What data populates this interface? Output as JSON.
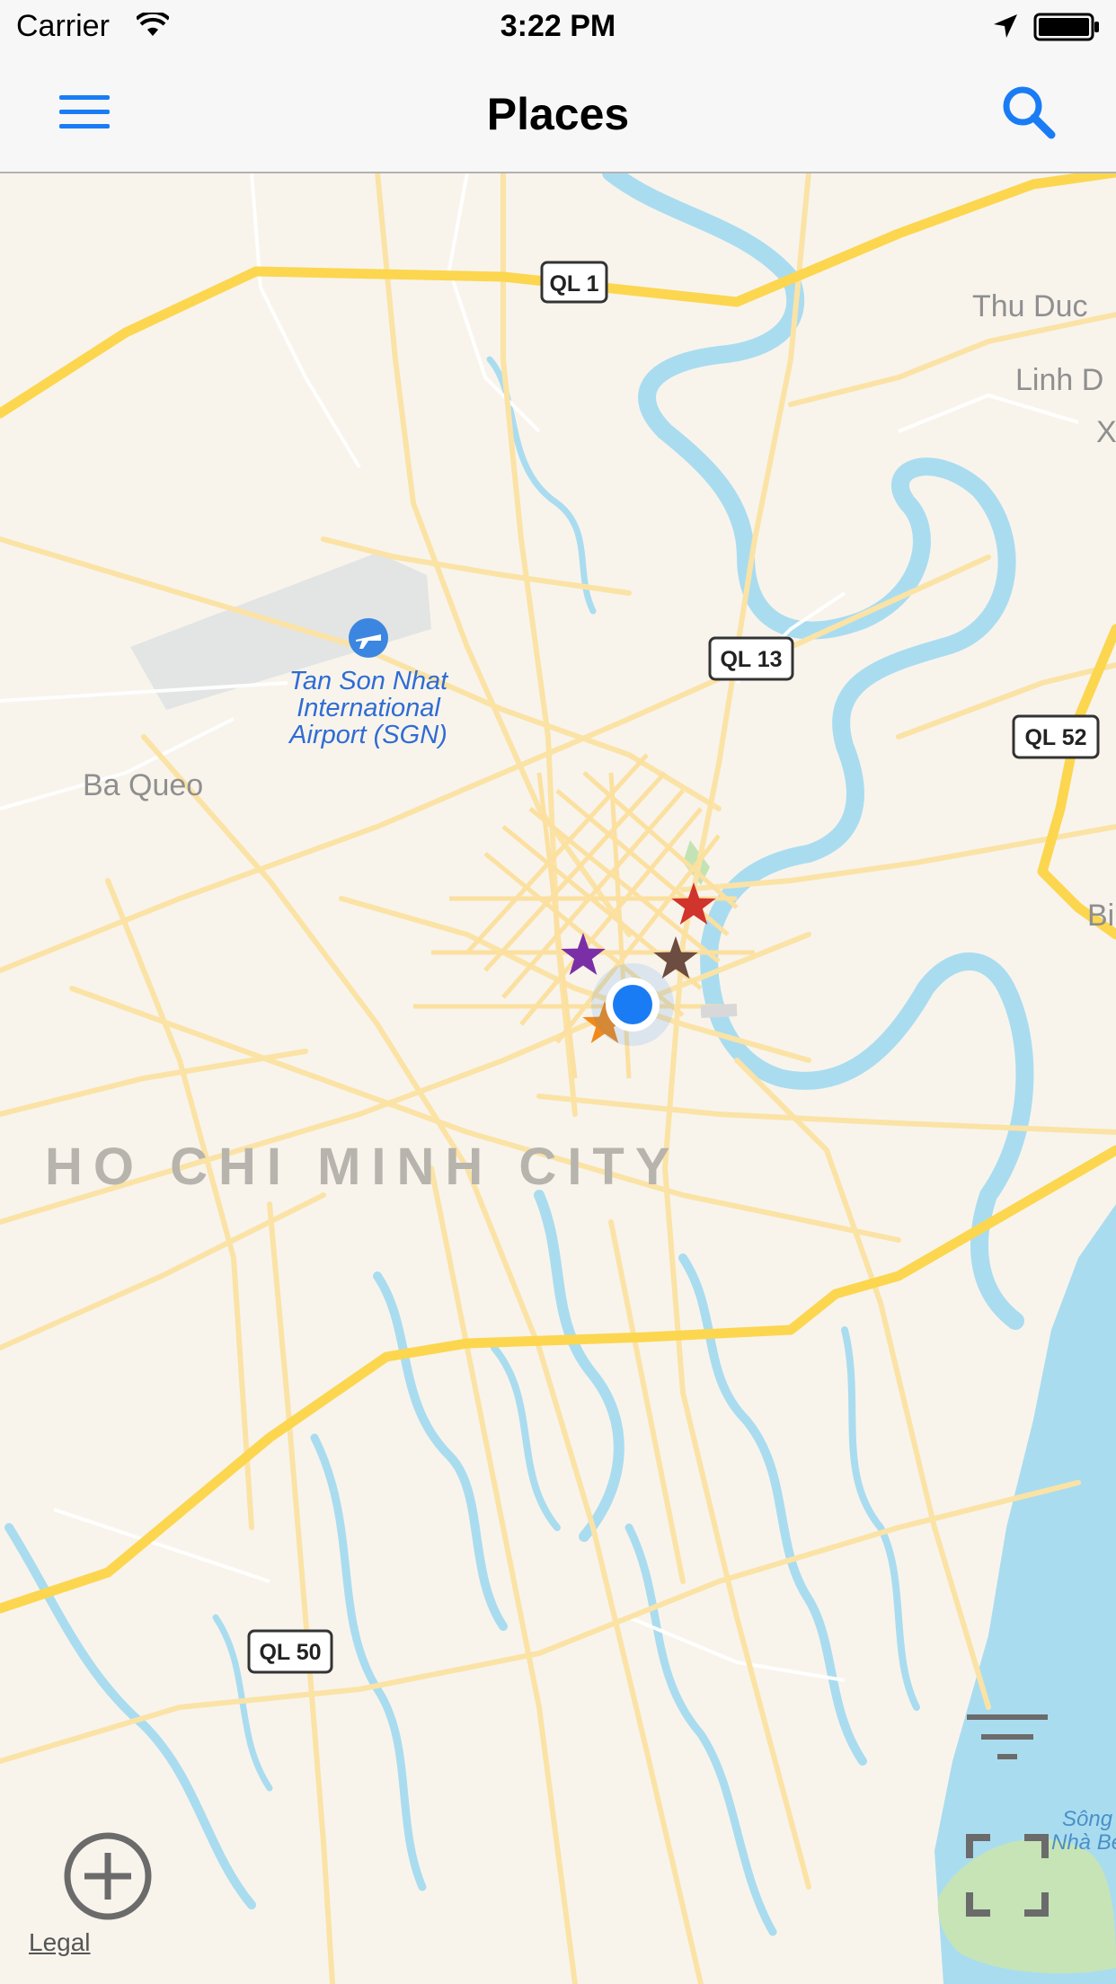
{
  "status_bar": {
    "carrier": "Carrier",
    "time": "3:22 PM"
  },
  "nav": {
    "title": "Places",
    "menu_icon": "hamburger-menu-icon",
    "search_icon": "magnifier-search-icon"
  },
  "map": {
    "road_labels": [
      "QL 1",
      "QL 13",
      "QL 52",
      "QL 50"
    ],
    "place_labels": {
      "thu_duc": "Thu Duc",
      "linh": "Linh D",
      "x": "X",
      "ba_queo": "Ba Queo",
      "bi": "Bi",
      "city": "HO CHI MINH CITY",
      "airport_line1": "Tan Son Nhat",
      "airport_line2": "International",
      "airport_line3": "Airport (SGN)",
      "song": "Sông",
      "nha_be": "Nhà Bè"
    },
    "markers": [
      {
        "name": "red-star-marker",
        "color": "#d0342c"
      },
      {
        "name": "brown-star-marker",
        "color": "#6d4c41"
      },
      {
        "name": "purple-star-marker",
        "color": "#7b2fa6"
      },
      {
        "name": "orange-star-marker",
        "color": "#f08a1c"
      }
    ],
    "colors": {
      "land": "#f8f4ec",
      "water": "#aadcf0",
      "highway": "#fcd64f",
      "road": "#fbe3a6",
      "park": "#c4e3b4"
    }
  },
  "controls": {
    "legal": "Legal",
    "zoom_icon": "zoom-in-plus-icon",
    "filter_icon": "filter-lines-icon",
    "fullscreen_icon": "fullscreen-corners-icon"
  }
}
